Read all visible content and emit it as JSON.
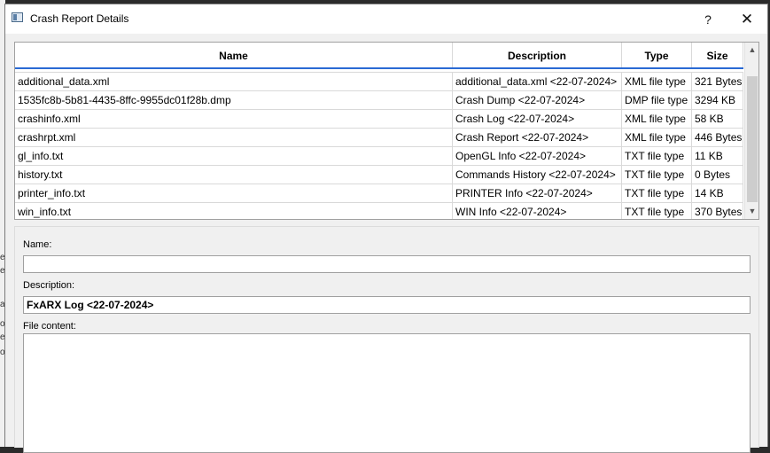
{
  "background": {
    "fragments": [
      "e",
      "e",
      "a",
      "o",
      "e",
      "o"
    ]
  },
  "window": {
    "title": "Crash Report Details",
    "help_label": "?",
    "close_label": "✕"
  },
  "table": {
    "columns": [
      "Name",
      "Description",
      "Type",
      "Size"
    ],
    "rows": [
      {
        "name": "additional_data.xml",
        "description": "additional_data.xml <22-07-2024>",
        "type": "XML file type",
        "size": "321 Bytes"
      },
      {
        "name": "1535fc8b-5b81-4435-8ffc-9955dc01f28b.dmp",
        "description": "Crash Dump <22-07-2024>",
        "type": "DMP file type",
        "size": "3294 KB"
      },
      {
        "name": "crashinfo.xml",
        "description": "Crash Log <22-07-2024>",
        "type": "XML file type",
        "size": "58 KB"
      },
      {
        "name": "crashrpt.xml",
        "description": "Crash Report <22-07-2024>",
        "type": "XML file type",
        "size": "446 Bytes"
      },
      {
        "name": "gl_info.txt",
        "description": "OpenGL Info <22-07-2024>",
        "type": "TXT file type",
        "size": "11 KB"
      },
      {
        "name": "history.txt",
        "description": "Commands History <22-07-2024>",
        "type": "TXT file type",
        "size": "0 Bytes"
      },
      {
        "name": "printer_info.txt",
        "description": "PRINTER Info <22-07-2024>",
        "type": "TXT file type",
        "size": "14 KB"
      },
      {
        "name": "win_info.txt",
        "description": "WIN Info <22-07-2024>",
        "type": "TXT file type",
        "size": "370 Bytes"
      }
    ]
  },
  "details": {
    "name_label": "Name:",
    "name_value": "",
    "description_label": "Description:",
    "description_value": "FxARX Log <22-07-2024>",
    "file_content_label": "File content:",
    "file_content_value": ""
  },
  "colors": {
    "header_accent": "#2a6ad4",
    "window_bg": "#f0f0f0"
  }
}
